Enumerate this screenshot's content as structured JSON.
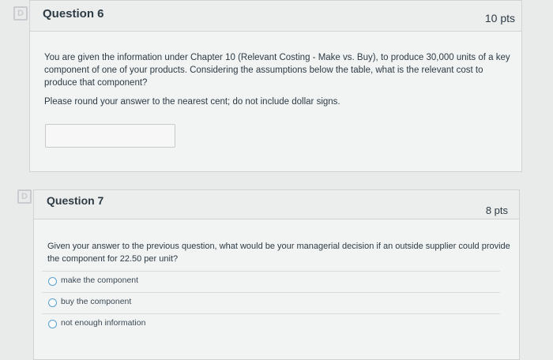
{
  "question6": {
    "title": "Question 6",
    "points": "10 pts",
    "text": "You are given the information under Chapter 10 (Relevant Costing - Make vs. Buy), to produce 30,000 units of a key component of one of your products. Considering the assumptions below the table, what is the relevant cost to produce that component?",
    "instruction": "Please round your answer to the nearest cent; do not include dollar signs.",
    "answer_value": ""
  },
  "question7": {
    "title": "Question 7",
    "points": "8 pts",
    "text": "Given your answer to the previous question, what would be your managerial decision if an outside supplier could provide the component for 22.50 per unit?",
    "options": [
      "make the component",
      "buy the component",
      "not enough information"
    ]
  },
  "colors": {
    "radio_border": "#5aa3cf",
    "text": "#2d3b45"
  },
  "icons": {
    "flag": "flag-icon"
  }
}
